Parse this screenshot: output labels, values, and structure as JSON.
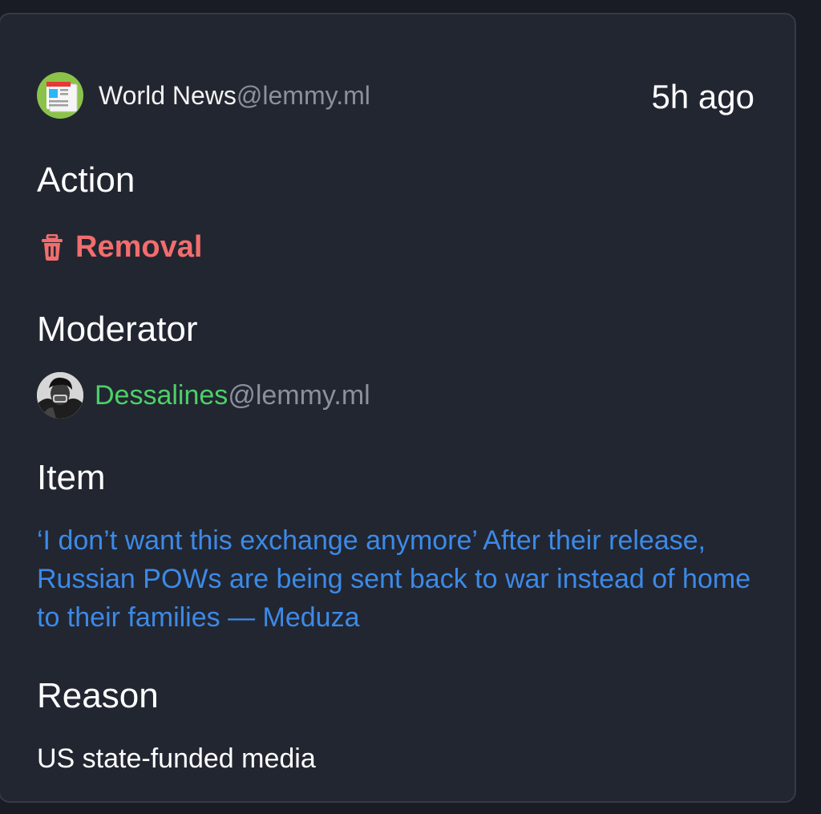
{
  "entry": {
    "community": {
      "name": "World News",
      "instance": "@lemmy.ml",
      "avatar_icon": "newspaper-icon"
    },
    "time": "5h ago",
    "action": {
      "title": "Action",
      "label": "Removal",
      "icon": "trash-icon",
      "color": "#f26d6d"
    },
    "moderator": {
      "title": "Moderator",
      "name": "Dessalines",
      "instance": "@lemmy.ml",
      "name_color": "#4dd068"
    },
    "item": {
      "title": "Item",
      "text": "‘I don’t want this exchange anymore’ After their release, Russian POWs are being sent back to war instead of home to their families — Meduza",
      "color": "#3c8ae8"
    },
    "reason": {
      "title": "Reason",
      "text": "US state-funded media"
    }
  }
}
